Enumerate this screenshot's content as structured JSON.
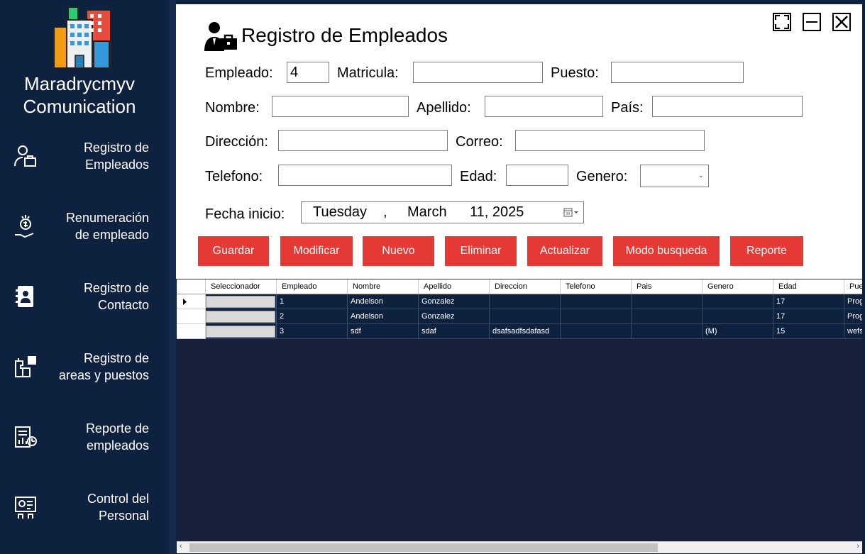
{
  "sidebar": {
    "brand": "Maradrycmyv\nComunication",
    "items": [
      {
        "label": "Registro de\nEmpleados",
        "icon": "employee-badge-icon"
      },
      {
        "label": "Renumeración\nde empleado",
        "icon": "money-hand-icon"
      },
      {
        "label": "Registro de\nContacto",
        "icon": "contact-book-icon"
      },
      {
        "label": "Registro de\nareas y puestos",
        "icon": "org-puzzle-icon"
      },
      {
        "label": "Reporte de\nempleados",
        "icon": "report-chart-icon"
      },
      {
        "label": "Control del\nPersonal",
        "icon": "monitor-person-icon"
      }
    ]
  },
  "form": {
    "title": "Registro de Empleados",
    "labels": {
      "empleado": "Empleado:",
      "matricula": "Matricula:",
      "puesto": "Puesto:",
      "nombre": "Nombre:",
      "apellido": "Apellido:",
      "pais": "País:",
      "direccion": "Dirección:",
      "correo": "Correo:",
      "telefono": "Telefono:",
      "edad": "Edad:",
      "genero": "Genero:",
      "fecha_inicio": "Fecha inicio:"
    },
    "values": {
      "empleado": "4",
      "matricula": "",
      "puesto": "",
      "nombre": "",
      "apellido": "",
      "pais": "",
      "direccion": "",
      "correo": "",
      "telefono": "",
      "edad": "",
      "genero": ""
    },
    "date": {
      "weekday": "Tuesday",
      "comma": ",",
      "month": "March",
      "day_year": "11, 2025"
    },
    "buttons": {
      "guardar": "Guardar",
      "modificar": "Modificar",
      "nuevo": "Nuevo",
      "eliminar": "Eliminar",
      "actualizar": "Actualizar",
      "modo_busqueda": "Modo busqueda",
      "reporte": "Reporte"
    },
    "accent_color": "#e53935"
  },
  "grid": {
    "columns": [
      "Seleccionador",
      "Empleado",
      "Nombre",
      "Apellido",
      "Direccion",
      "Telefono",
      "Pais",
      "Genero",
      "Edad",
      "Pue"
    ],
    "rows": [
      {
        "empleado": "1",
        "nombre": "Andelson",
        "apellido": "Gonzalez",
        "direccion": "",
        "telefono": "",
        "pais": "",
        "genero": "",
        "edad": "17",
        "puesto": "Prog"
      },
      {
        "empleado": "2",
        "nombre": "Andelson",
        "apellido": "Gonzalez",
        "direccion": "",
        "telefono": "",
        "pais": "",
        "genero": "",
        "edad": "17",
        "puesto": "Prog"
      },
      {
        "empleado": "3",
        "nombre": "sdf",
        "apellido": "sdaf",
        "direccion": "dsafsadfsdafasd",
        "telefono": "",
        "pais": "",
        "genero": "(M)",
        "edad": "15",
        "puesto": "wefs"
      }
    ]
  }
}
